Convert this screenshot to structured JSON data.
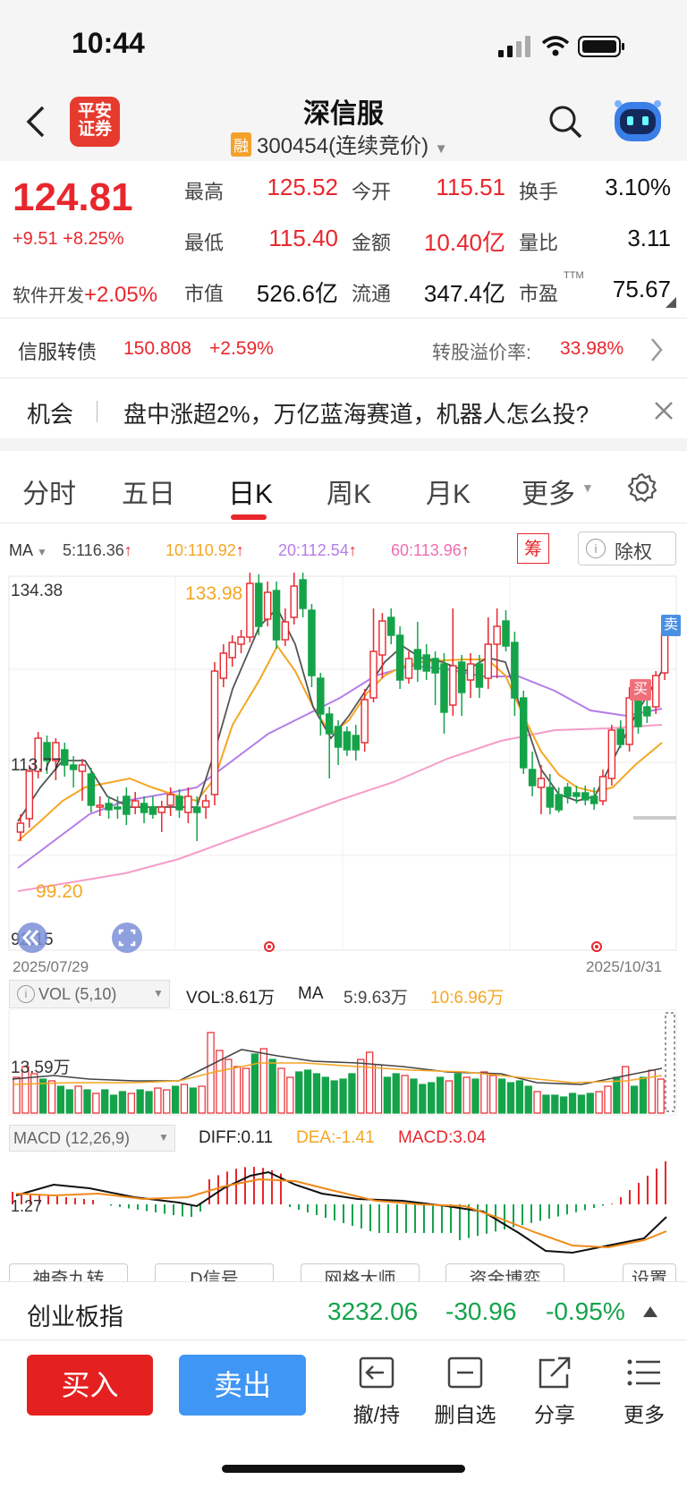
{
  "status": {
    "time": "10:44"
  },
  "header": {
    "title": "深信服",
    "badge": "融",
    "code": "300454(连续竞价)"
  },
  "quote": {
    "price": "124.81",
    "change": "+9.51",
    "change_pct": "+8.25%",
    "sector_name": "软件开发",
    "sector_pct": "+2.05%",
    "stats": [
      {
        "label": "最高",
        "value": "125.52"
      },
      {
        "label": "今开",
        "value": "115.51"
      },
      {
        "label": "换手",
        "value": "3.10%"
      },
      {
        "label": "最低",
        "value": "115.40"
      },
      {
        "label": "金额",
        "value": "10.40亿"
      },
      {
        "label": "量比",
        "value": "3.11"
      },
      {
        "label": "市值",
        "value": "526.6亿"
      },
      {
        "label": "流通",
        "value": "347.4亿"
      },
      {
        "label": "市盈",
        "value": "75.67",
        "sup": "TTM"
      }
    ]
  },
  "bond": {
    "name": "信服转债",
    "price": "150.808",
    "pct": "+2.59%",
    "premium_label": "转股溢价率:",
    "premium": "33.98%"
  },
  "news": {
    "tag": "机会",
    "text": "盘中涨超2%，万亿蓝海赛道，机器人怎么投?"
  },
  "tabs": [
    "分时",
    "五日",
    "日K",
    "周K",
    "月K",
    "更多"
  ],
  "ma": {
    "label": "MA",
    "ma5": "5:116.36",
    "ma10": "10:110.92",
    "ma20": "20:112.54",
    "ma60": "60:113.96",
    "chip": "筹",
    "fuquan": "除权"
  },
  "kline": {
    "y_top": "134.38",
    "y_mid": "113.77",
    "y_bot": "92.15",
    "high_label": "133.98",
    "low_label": "99.20",
    "date_start": "2025/07/29",
    "date_end": "2025/10/31",
    "sell_mark": "卖",
    "buy_mark": "买"
  },
  "vol": {
    "label": "VOL (5,10)",
    "vol": "VOL:8.61万",
    "ma_label": "MA",
    "ma5": "5:9.63万",
    "ma10": "10:6.96万",
    "y_label": "13.59万"
  },
  "macd": {
    "label": "MACD (12,26,9)",
    "diff": "DIFF:0.11",
    "dea": "DEA:-1.41",
    "macd": "MACD:3.04",
    "y_label": "1.27"
  },
  "indicator_tabs": [
    "神奇九转",
    "D信号",
    "网格大师",
    "资金博弈",
    "设置"
  ],
  "index": {
    "name": "创业板指",
    "value": "3232.06",
    "change": "-30.96",
    "pct": "-0.95%"
  },
  "bottom": {
    "buy": "买入",
    "sell": "卖出",
    "items": [
      "撤/持",
      "删自选",
      "分享",
      "更多"
    ]
  },
  "colors": {
    "up": "#e8272d",
    "down": "#15a34a",
    "ma5": "#555555",
    "ma10": "#f5a623",
    "ma20": "#b57ce8",
    "ma60": "#f59cc9",
    "sell_btn": "#3f96f5"
  }
}
